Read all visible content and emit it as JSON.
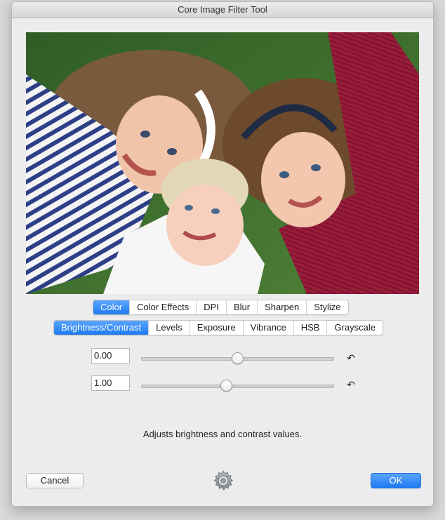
{
  "window": {
    "title": "Core Image Filter Tool"
  },
  "photo": {
    "alt": ""
  },
  "categories": [
    {
      "label": "Color",
      "selected": true
    },
    {
      "label": "Color Effects",
      "selected": false
    },
    {
      "label": "DPI",
      "selected": false
    },
    {
      "label": "Blur",
      "selected": false
    },
    {
      "label": "Sharpen",
      "selected": false
    },
    {
      "label": "Stylize",
      "selected": false
    }
  ],
  "filters": [
    {
      "label": "Brightness/Contrast",
      "selected": true
    },
    {
      "label": "Levels",
      "selected": false
    },
    {
      "label": "Exposure",
      "selected": false
    },
    {
      "label": "Vibrance",
      "selected": false
    },
    {
      "label": "HSB",
      "selected": false
    },
    {
      "label": "Grayscale",
      "selected": false
    }
  ],
  "params": {
    "brightness": {
      "value": "0.00",
      "slider_fraction": 0.5
    },
    "contrast": {
      "value": "1.00",
      "slider_fraction": 0.44
    }
  },
  "reset_icon": "reset-arrow-icon",
  "description": "Adjusts brightness and contrast values.",
  "buttons": {
    "cancel": "Cancel",
    "ok": "OK"
  },
  "colors": {
    "accent": "#1e7af0",
    "window_bg": "#ececec"
  }
}
